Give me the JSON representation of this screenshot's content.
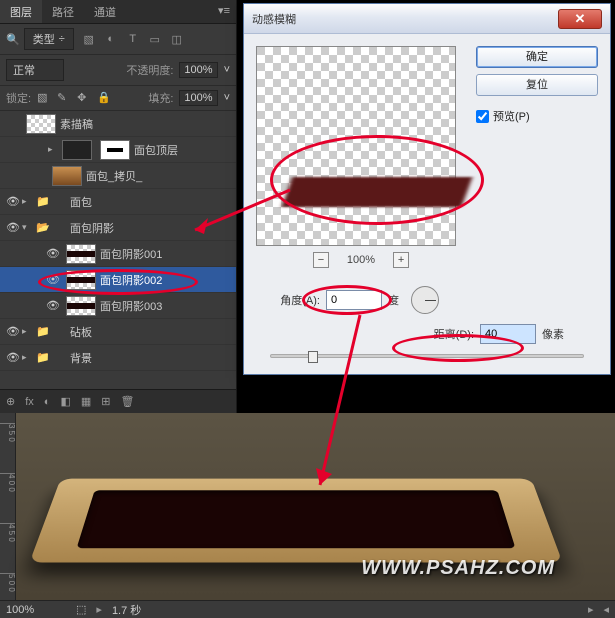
{
  "panel": {
    "tabs": [
      "图层",
      "路径",
      "通道"
    ],
    "typeLabel": "类型",
    "blendMode": "正常",
    "opacityLabel": "不透明度:",
    "opacityValue": "100%",
    "lockLabel": "锁定:",
    "fillLabel": "填充:",
    "fillValue": "100%",
    "layers": [
      {
        "name": "素描稿",
        "vis": false,
        "thumb": "checker"
      },
      {
        "name": "面包顶层",
        "vis": false,
        "thumb": "mask",
        "sub": true,
        "hasMask": true
      },
      {
        "name": "面包_拷贝_",
        "vis": false,
        "thumb": "img",
        "sub": true
      },
      {
        "name": "面包",
        "vis": true,
        "folder": true,
        "open": false
      },
      {
        "name": "面包阴影",
        "vis": true,
        "folder": true,
        "open": true
      },
      {
        "name": "面包阴影001",
        "vis": true,
        "thumb": "dark",
        "sub2": true
      },
      {
        "name": "面包阴影002",
        "vis": true,
        "thumb": "dark",
        "sub2": true,
        "selected": true
      },
      {
        "name": "面包阴影003",
        "vis": true,
        "thumb": "dark",
        "sub2": true
      },
      {
        "name": "砧板",
        "vis": true,
        "folder": true,
        "open": false
      },
      {
        "name": "背景",
        "vis": true,
        "folder": true,
        "open": false
      }
    ],
    "footIcons": [
      "⊕",
      "fx",
      "◐",
      "◧",
      "▦",
      "⊞",
      "🗑"
    ]
  },
  "dialog": {
    "title": "动感模糊",
    "ok": "确定",
    "reset": "复位",
    "previewChk": "预览(P)",
    "previewZoom": "100%",
    "angleLabel": "角度(A):",
    "angleValue": "0",
    "angleUnit": "度",
    "distLabel": "距离(D):",
    "distValue": "40",
    "distUnit": "像素"
  },
  "status": {
    "zoom": "100%",
    "time": "1.7 秒"
  },
  "ruler": {
    "t350": "3 5 0",
    "t400": "4 0 0",
    "t450": "4 5 0",
    "t500": "5 0 0"
  },
  "watermark": "WWW.PSAHZ.COM"
}
